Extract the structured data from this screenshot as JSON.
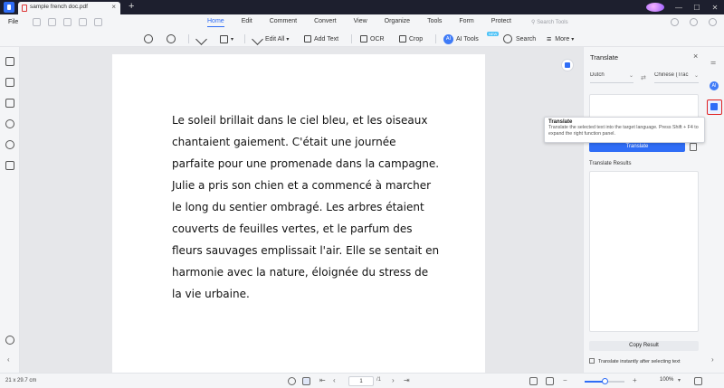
{
  "tab": {
    "filename": "sample french doc.pdf",
    "close": "×",
    "new_tab": "+"
  },
  "menubar": {
    "file": "File",
    "tabs": [
      {
        "label": "Home",
        "active": true
      },
      {
        "label": "Edit"
      },
      {
        "label": "Comment"
      },
      {
        "label": "Convert"
      },
      {
        "label": "View"
      },
      {
        "label": "Organize"
      },
      {
        "label": "Tools"
      },
      {
        "label": "Form"
      },
      {
        "label": "Protect"
      }
    ],
    "search_placeholder": "Search Tools"
  },
  "toolbar": {
    "edit_all": "Edit All",
    "add_text": "Add Text",
    "ocr": "OCR",
    "crop": "Crop",
    "ai_tools": "AI Tools",
    "ai_badge": "NEW",
    "search": "Search",
    "more": "More"
  },
  "document": {
    "text": "Le soleil brillait dans le ciel bleu, et les oiseaux chantaient gaiement. C'était une journée parfaite pour une promenade dans la campagne. Julie a pris son chien et a commencé à marcher le long du sentier ombragé. Les arbres étaient couverts de feuilles vertes, et le parfum des fleurs sauvages emplissait l'air. Elle se sentait en harmonie avec la nature, éloignée du stress de la vie urbaine."
  },
  "translate_panel": {
    "title": "Translate",
    "source_lang": "Dutch",
    "target_lang": "Chinese (Trac",
    "translate_button": "Translate",
    "results_label": "Translate Results",
    "copy_button": "Copy Result",
    "instant_option": "Translate instantly after selecting text"
  },
  "right_rail": {
    "ai_label": "AI"
  },
  "tooltip": {
    "title": "Translate",
    "body": "Translate the selected text into the target language. Press Shift + F4 to expand the right function panel."
  },
  "statusbar": {
    "page_size": "21 x 29.7 cm",
    "page_current": "1",
    "page_total": "/1",
    "zoom": "100%",
    "zoom_level": 0.5
  },
  "colors": {
    "accent": "#2f6df6",
    "highlight_border": "#e02020",
    "tabbar_bg": "#1d1f2e"
  },
  "icons": {
    "zoom_out": "zoom-out-icon",
    "zoom_in": "zoom-in-icon",
    "highlighter": "highlighter-icon",
    "rectangle": "rectangle-icon",
    "edit": "edit-icon",
    "add_text": "add-text-icon",
    "ocr": "ocr-icon",
    "crop": "crop-icon",
    "ai": "ai-icon",
    "search": "search-icon",
    "more": "more-icon",
    "translate": "translate-icon"
  }
}
